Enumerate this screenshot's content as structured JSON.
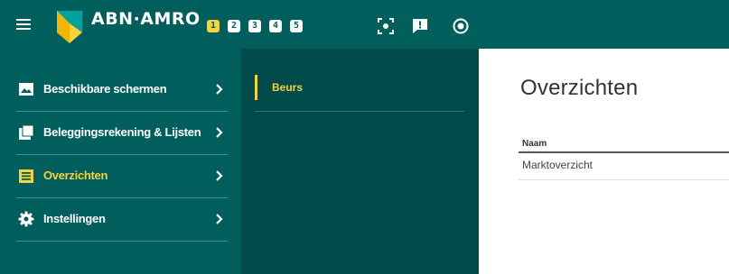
{
  "header": {
    "brand": "ABN·AMRO",
    "workspaces": [
      "1",
      "2",
      "3",
      "4",
      "5"
    ],
    "active_workspace": 0,
    "tools": [
      "screenshot-icon",
      "feedback-icon",
      "record-icon"
    ]
  },
  "sidebar": {
    "items": [
      {
        "label": "Beschikbare schermen",
        "icon": "screens-icon",
        "active": false
      },
      {
        "label": "Beleggingsrekening & Lijsten",
        "icon": "portfolio-icon",
        "active": false
      },
      {
        "label": "Overzichten",
        "icon": "overview-icon",
        "active": true
      },
      {
        "label": "Instellingen",
        "icon": "gear-icon",
        "active": false
      }
    ]
  },
  "subpanel": {
    "items": [
      {
        "label": "Beurs",
        "active": true
      }
    ]
  },
  "content": {
    "title": "Overzichten",
    "table": {
      "header": "Naam",
      "rows": [
        "Marktoverzicht"
      ]
    }
  },
  "colors": {
    "brand_green": "#005e5d",
    "panel_green": "#004b4a",
    "accent_yellow": "#f7d23a"
  }
}
